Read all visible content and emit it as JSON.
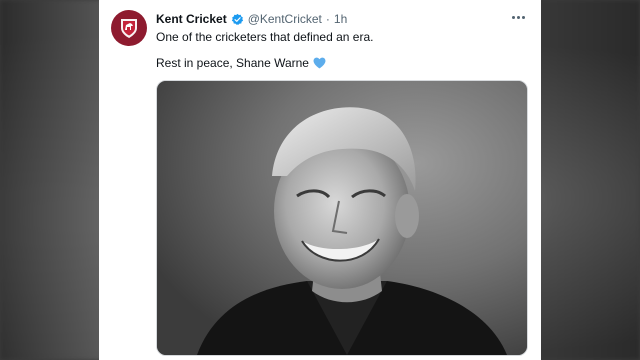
{
  "tweet": {
    "display_name": "Kent Cricket",
    "handle": "@KentCricket",
    "separator": "·",
    "time": "1h",
    "line1": "One of the cricketers that defined an era.",
    "line2": "Rest in peace, Shane Warne",
    "heart_icon": "blue-heart-emoji",
    "verified_icon": "verified-badge-icon",
    "more_icon": "more-options-icon"
  },
  "colors": {
    "accent": "#1d9bf0",
    "brand": "#8e1b2f",
    "text": "#0f1419",
    "muted": "#536471",
    "heart": "#5dadec"
  }
}
